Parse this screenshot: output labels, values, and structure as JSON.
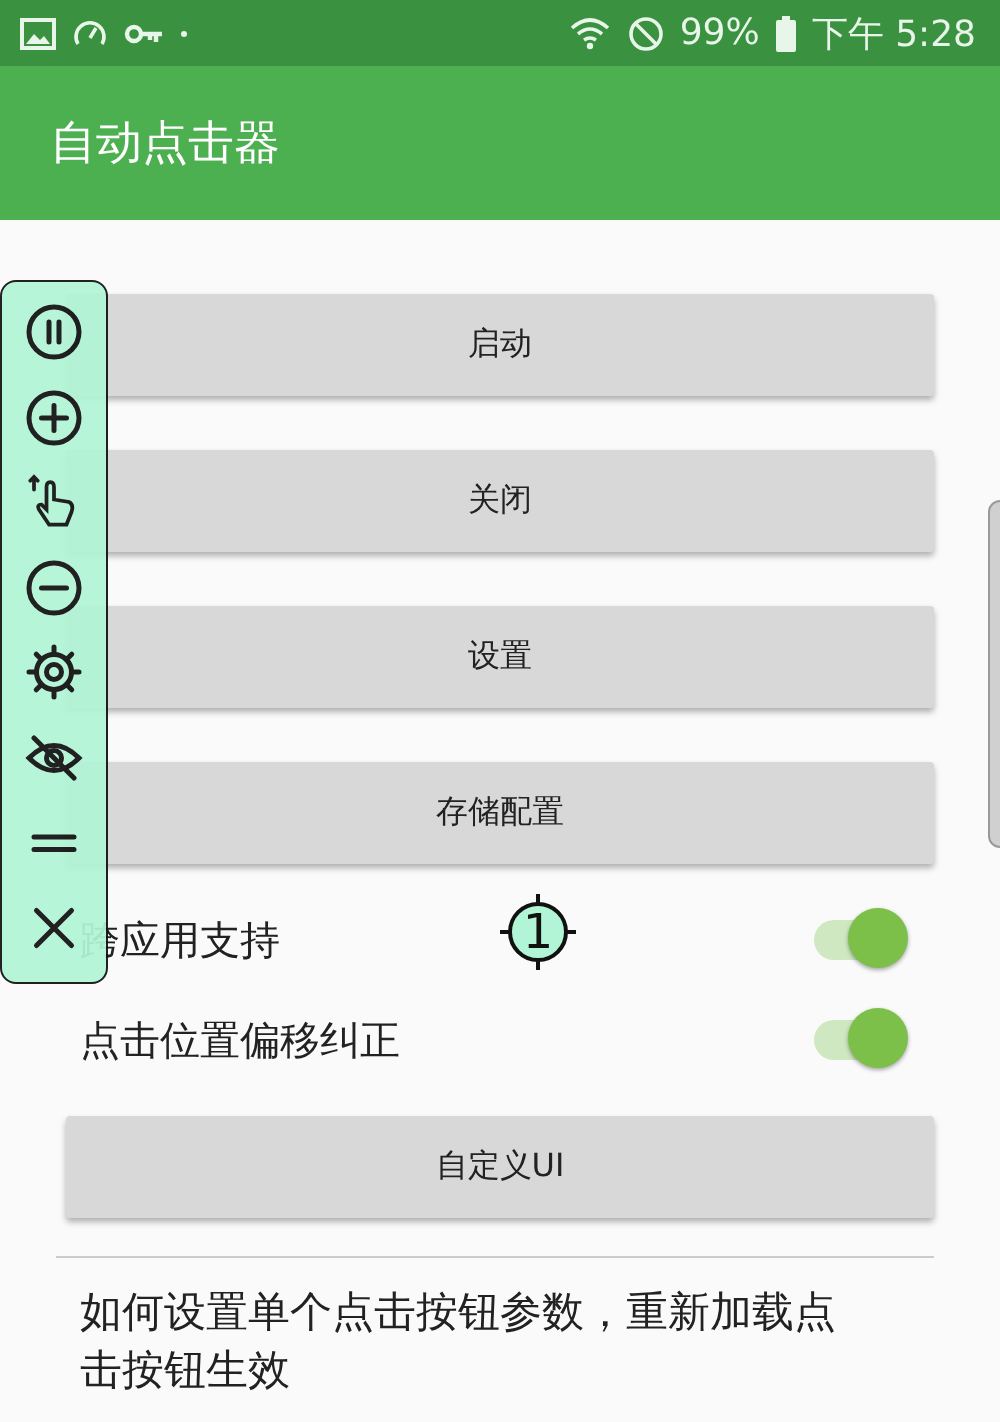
{
  "status_bar": {
    "battery": "99%",
    "time": "下午 5:28"
  },
  "app_bar": {
    "title": "自动点击器"
  },
  "buttons": [
    {
      "label": "启动"
    },
    {
      "label": "关闭"
    },
    {
      "label": "设置"
    },
    {
      "label": "存储配置"
    }
  ],
  "switches": [
    {
      "label": "跨应用支持",
      "on": true
    },
    {
      "label": "点击位置偏移纠正",
      "on": true
    }
  ],
  "custom_button": {
    "label": "自定义UI"
  },
  "help_item": {
    "title": "如何设置单个点击按钮参数，重新加载点击按钮生效"
  },
  "click_marker": {
    "label": "1"
  }
}
